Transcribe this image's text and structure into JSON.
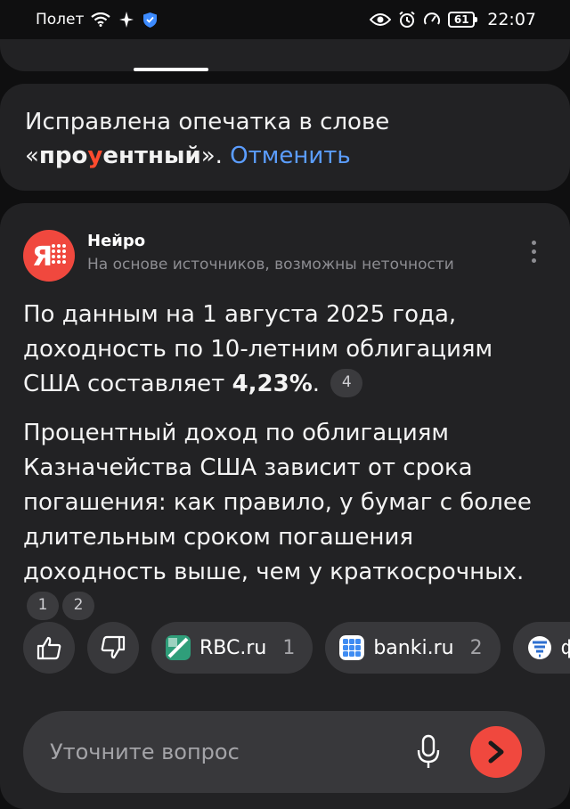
{
  "status_bar": {
    "carrier": "Полет",
    "battery": "61",
    "time": "22:07"
  },
  "correction_notice": {
    "prefix": "Исправлена опечатка в слове",
    "open_quote": "«",
    "word_start": "про",
    "word_highlight": "у",
    "word_end": "ентный",
    "close_quote": "»",
    "separator": ". ",
    "undo_label": "Отменить"
  },
  "answer": {
    "author": "Нейро",
    "disclaimer": "На основе источников, возможны неточности",
    "paragraph1_text": "По данным на 1 августа 2025 года, доходность по 10-летним облигациям США составляет ",
    "paragraph1_bold": "4,23%",
    "paragraph1_end": ".",
    "paragraph1_refs": [
      "4"
    ],
    "paragraph2_text": "Процентный доход по облигациям Казначейства США зависит от срока погашения: как правило, у бумаг с более длительным сроком погашения доходность выше, чем у краткосрочных.",
    "paragraph2_refs": [
      "1",
      "2"
    ]
  },
  "sources": [
    {
      "name": "RBC.ru",
      "count": "1"
    },
    {
      "name": "banki.ru",
      "count": "2"
    },
    {
      "name": "ф",
      "count": ""
    }
  ],
  "input": {
    "placeholder": "Уточните вопрос"
  },
  "colors": {
    "accent": "#f0483e",
    "link": "#5b9dff",
    "card": "#222224"
  }
}
